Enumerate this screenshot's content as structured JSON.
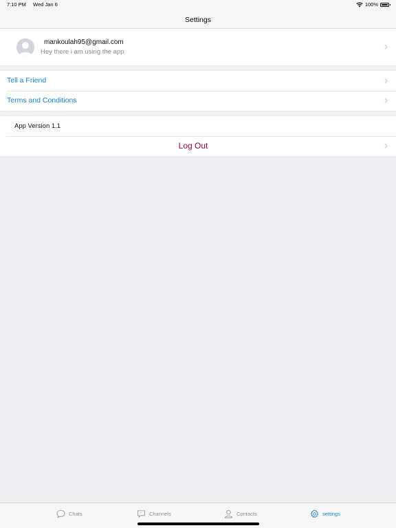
{
  "status_bar": {
    "time": "7:10 PM",
    "date": "Wed Jan 6",
    "battery": "100%"
  },
  "nav": {
    "title": "Settings"
  },
  "profile": {
    "email": "mankoulah95@gmail.com",
    "status": "Hey there i am using the app"
  },
  "links": [
    {
      "label": "Tell a Friend"
    },
    {
      "label": "Terms and Conditions"
    }
  ],
  "info": {
    "version": "App Version 1.1",
    "logout": "Log Out"
  },
  "tabs": [
    {
      "label": "Chats",
      "icon": "chat-bubble-icon"
    },
    {
      "label": "Channels",
      "icon": "channel-icon"
    },
    {
      "label": "Contacts",
      "icon": "person-icon"
    },
    {
      "label": "settings",
      "icon": "gear-icon",
      "active": true
    }
  ],
  "colors": {
    "link": "#1c7fd0",
    "logout": "#8b0d2a",
    "background": "#efeff4",
    "tab_inactive": "#8e8e93"
  }
}
